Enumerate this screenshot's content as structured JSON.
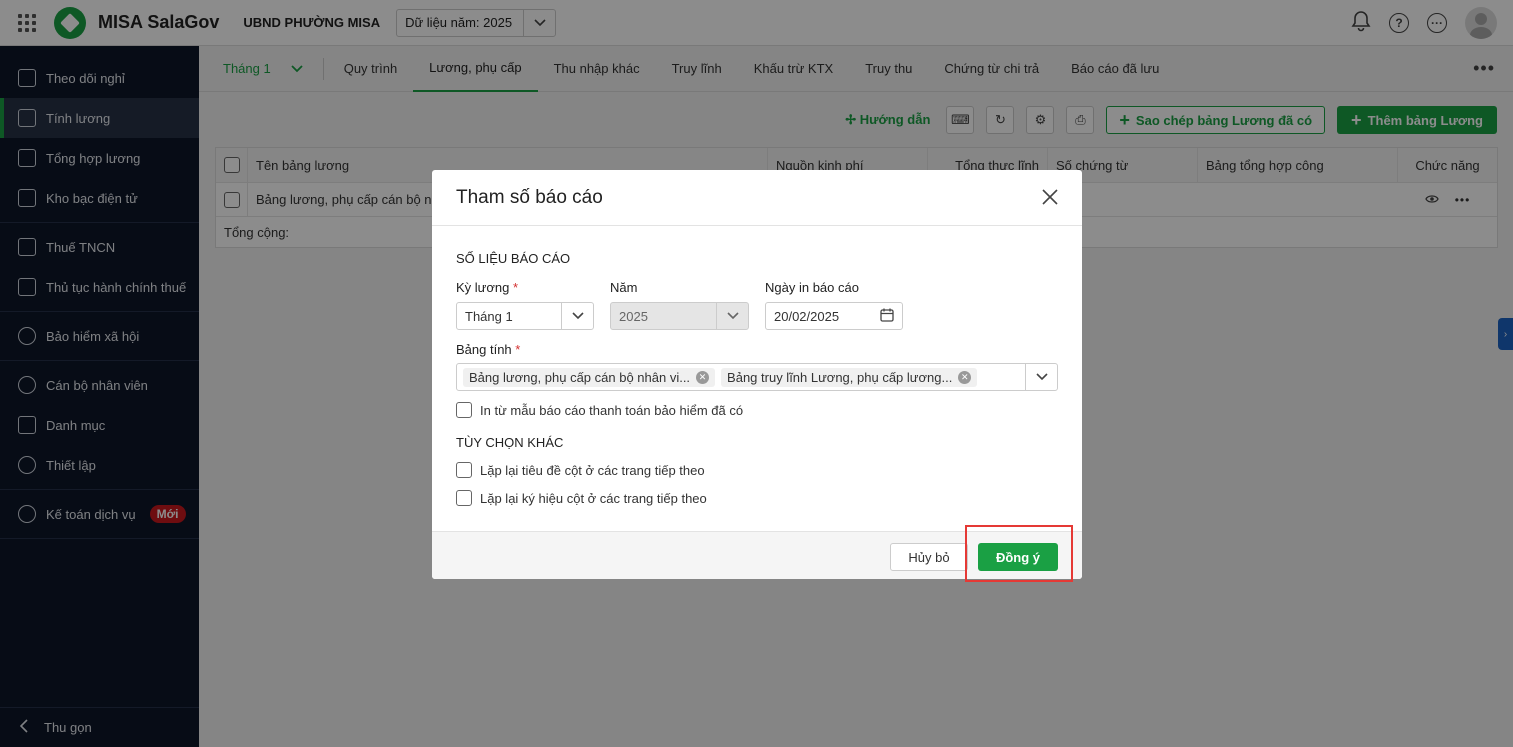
{
  "topbar": {
    "brand": "MISA SalaGov",
    "unit": "UBND PHƯỜNG MISA",
    "year_select": "Dữ liệu năm: 2025"
  },
  "sidebar": {
    "items": [
      {
        "label": "Theo dõi nghỉ"
      },
      {
        "label": "Tính lương"
      },
      {
        "label": "Tổng hợp lương"
      },
      {
        "label": "Kho bạc điện tử"
      },
      {
        "label": "Thuế TNCN"
      },
      {
        "label": "Thủ tục hành chính thuế"
      },
      {
        "label": "Bảo hiểm xã hội"
      },
      {
        "label": "Cán bộ nhân viên"
      },
      {
        "label": "Danh mục"
      },
      {
        "label": "Thiết lập"
      },
      {
        "label": "Kế toán dịch vụ"
      }
    ],
    "new_badge": "Mới",
    "collapse_label": "Thu gọn"
  },
  "tabs": {
    "month": "Tháng 1",
    "items": [
      "Quy trình",
      "Lương, phụ cấp",
      "Thu nhập khác",
      "Truy lĩnh",
      "Khấu trừ KTX",
      "Truy thu",
      "Chứng từ chi trả",
      "Báo cáo đã lưu"
    ],
    "active": "Lương, phụ cấp"
  },
  "toolbar": {
    "guide": "Hướng dẫn",
    "copy_button": "Sao chép bảng Lương đã có",
    "add_button": "Thêm bảng Lương"
  },
  "table": {
    "columns": [
      "Tên bảng lương",
      "Nguồn kinh phí",
      "Tổng thực lĩnh",
      "Số chứng từ",
      "Bảng tổng hợp công",
      "Chức năng"
    ],
    "rows": [
      {
        "name": "Bảng lương, phụ cấp cán bộ nh"
      }
    ],
    "total_label": "Tổng cộng:"
  },
  "modal": {
    "title": "Tham số báo cáo",
    "section1": "SỐ LIỆU BÁO CÁO",
    "period_label": "Kỳ lương",
    "period_value": "Tháng 1",
    "year_label": "Năm",
    "year_value": "2025",
    "print_date_label": "Ngày in báo cáo",
    "print_date_value": "20/02/2025",
    "sheet_label": "Bảng tính",
    "sheet_chips": [
      "Bảng lương, phụ cấp cán bộ nhân vi...",
      "Bảng truy lĩnh Lương, phụ cấp lương..."
    ],
    "insurance_check": "In từ mẫu báo cáo thanh toán bảo hiểm đã có",
    "section2": "TÙY CHỌN KHÁC",
    "repeat_title_check": "Lặp lại tiêu đề cột ở các trang tiếp theo",
    "repeat_symbol_check": "Lặp lại ký hiệu cột ở các trang tiếp theo",
    "cancel": "Hủy bỏ",
    "ok": "Đồng ý"
  }
}
